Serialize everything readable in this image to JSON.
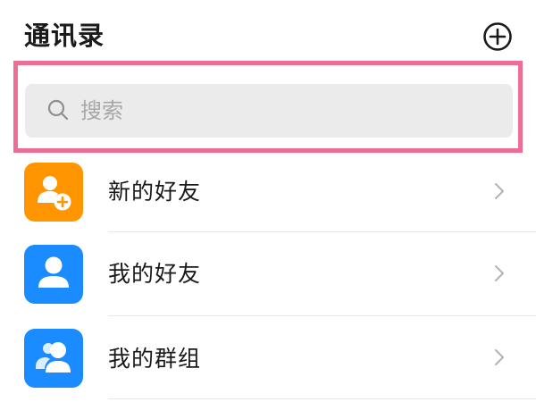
{
  "header": {
    "title": "通讯录"
  },
  "search": {
    "placeholder": "搜索"
  },
  "items": [
    {
      "label": "新的好友",
      "icon": "add-friend-icon",
      "color": "#ff9500"
    },
    {
      "label": "我的好友",
      "icon": "person-icon",
      "color": "#1a8cff"
    },
    {
      "label": "我的群组",
      "icon": "group-icon",
      "color": "#1a8cff"
    }
  ],
  "colors": {
    "highlight": "#ee6d95",
    "search_bg": "#ebebec"
  }
}
